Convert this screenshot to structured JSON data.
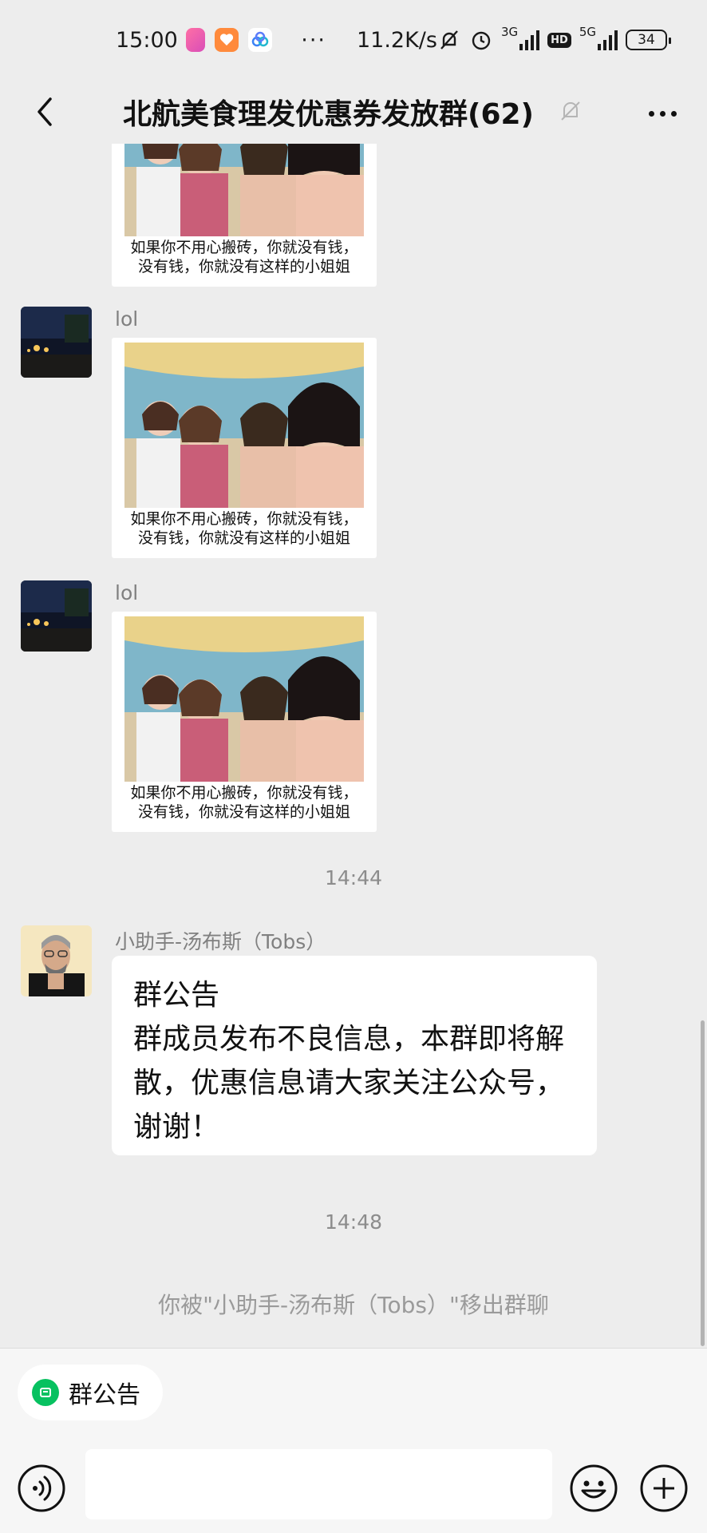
{
  "status_bar": {
    "time": "15:00",
    "dots": "···",
    "net_speed": "11.2K/s",
    "net1": "3G",
    "net2": "5G",
    "hd": "HD",
    "battery": "34",
    "icons": [
      "bilibili-app-icon",
      "hello-app-icon",
      "cloud-app-icon",
      "silent-bell-icon",
      "alarm-icon",
      "signal-icon",
      "battery-icon"
    ]
  },
  "nav": {
    "title": "北航美食理发优惠券发放群(62)",
    "back_icon": "chevron-left-icon",
    "mute_icon": "bell-off-icon",
    "more_icon": "more-icon"
  },
  "messages": {
    "partial_image": {
      "caption_line1": "如果你不用心搬砖，你就没有钱，",
      "caption_line2": "没有钱，你就没有这样的小姐姐"
    },
    "image1": {
      "sender": "lol",
      "caption_line1": "如果你不用心搬砖，你就没有钱，",
      "caption_line2": "没有钱，你就没有这样的小姐姐"
    },
    "image2": {
      "sender": "lol",
      "caption_line1": "如果你不用心搬砖，你就没有钱，",
      "caption_line2": "没有钱，你就没有这样的小姐姐"
    },
    "time1": "14:44",
    "notice": {
      "sender": "小助手-汤布斯（Tobs）",
      "line1": "群公告",
      "line2": "群成员发布不良信息，本群即将解",
      "line3": "散，优惠信息请大家关注公众号，",
      "line4": "谢谢！"
    },
    "time2": "14:48",
    "system": "你被\"小助手-汤布斯（Tobs）\"移出群聊"
  },
  "bottom": {
    "notice_chip": "群公告",
    "notice_chip_icon": "announcement-icon",
    "voice_icon": "voice-icon",
    "emoji_icon": "emoji-icon",
    "plus_icon": "plus-icon",
    "input_value": ""
  },
  "colors": {
    "background": "#ededed",
    "bubble": "#ffffff",
    "accent_green": "#07c160",
    "muted_text": "#8c8c8c"
  }
}
